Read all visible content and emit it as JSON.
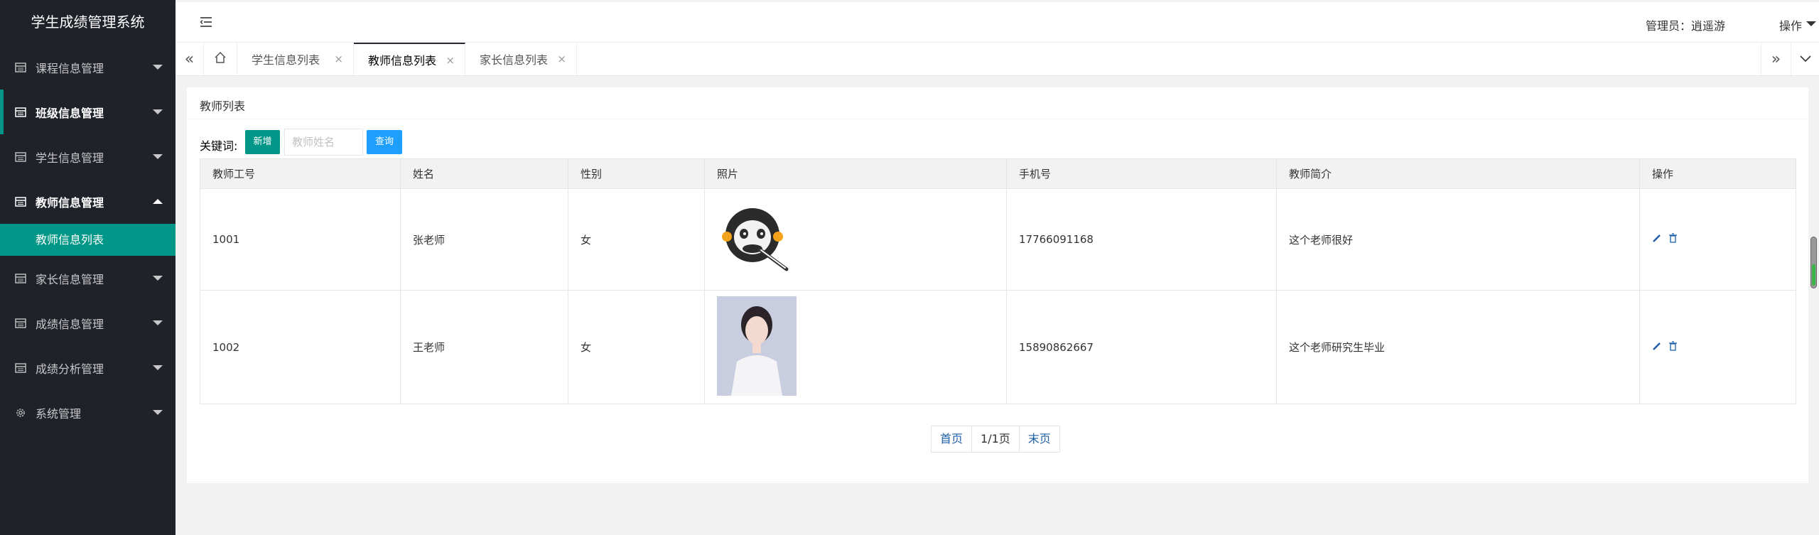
{
  "app": {
    "title": "学生成绩管理系统"
  },
  "sidebar": {
    "items": [
      {
        "label": "课程信息管理"
      },
      {
        "label": "班级信息管理"
      },
      {
        "label": "学生信息管理"
      },
      {
        "label": "教师信息管理",
        "expanded": true,
        "children": [
          {
            "label": "教师信息列表",
            "selected": true
          }
        ]
      },
      {
        "label": "家长信息管理"
      },
      {
        "label": "成绩信息管理"
      },
      {
        "label": "成绩分析管理"
      },
      {
        "label": "系统管理"
      }
    ]
  },
  "header": {
    "admin": "管理员：逍遥游",
    "operations": "操作"
  },
  "tabs": [
    {
      "label": "学生信息列表"
    },
    {
      "label": "教师信息列表",
      "active": true
    },
    {
      "label": "家长信息列表"
    }
  ],
  "tab_close": "×",
  "card": {
    "title": "教师列表"
  },
  "search": {
    "label": "关键词:",
    "placeholder": "教师姓名",
    "add_label": "新增",
    "search_label": "查询"
  },
  "table": {
    "headers": [
      "教师工号",
      "姓名",
      "性别",
      "照片",
      "手机号",
      "教师简介",
      "操作"
    ],
    "rows": [
      {
        "id": "1001",
        "name": "张老师",
        "gender": "女",
        "phone": "17766091168",
        "intro": "这个老师很好"
      },
      {
        "id": "1002",
        "name": "王老师",
        "gender": "女",
        "phone": "15890862667",
        "intro": "这个老师研究生毕业"
      }
    ]
  },
  "pagination": {
    "first": "首页",
    "current": "1/1页",
    "last": "末页"
  },
  "colors": {
    "sidebar": "#20222a",
    "accent": "#009688",
    "blue": "#1e9fff"
  }
}
